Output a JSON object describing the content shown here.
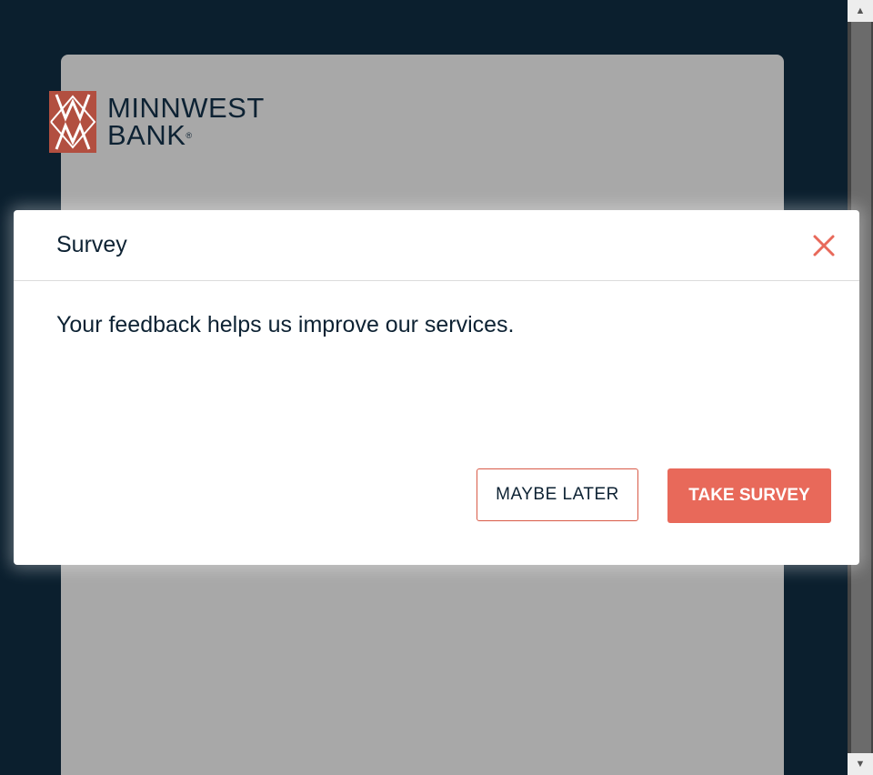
{
  "brand": {
    "name_line1": "MINNWEST",
    "name_line2": "BANK",
    "registered_mark": "®",
    "logo_color": "#b24f40"
  },
  "modal": {
    "title": "Survey",
    "close_icon": "close-icon",
    "message": "Your feedback helps us improve our services.",
    "maybe_later_label": "MAYBE LATER",
    "take_survey_label": "TAKE SURVEY",
    "accent_color": "#e8695a"
  },
  "scrollbar": {
    "up_arrow": "▲",
    "down_arrow": "▼"
  }
}
